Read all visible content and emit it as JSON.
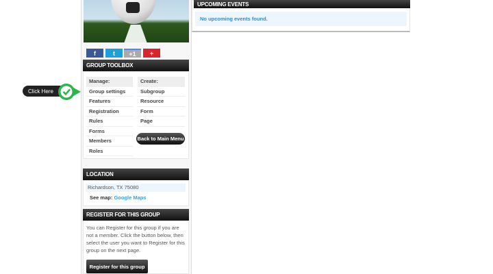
{
  "social": {
    "facebook": "f",
    "twitter": "t",
    "gplus": "+1",
    "more": "+"
  },
  "toolbox": {
    "title": "GROUP TOOLBOX",
    "manage_label": "Manage:",
    "manage_items": [
      "Group settings",
      "Features",
      "Registration",
      "Rules",
      "Forms",
      "Members",
      "Roles"
    ],
    "create_label": "Create:",
    "create_items": [
      "Subgroup",
      "Resource",
      "Form",
      "Page"
    ],
    "back_button": "Back to Main Menu"
  },
  "callout": {
    "label": "Click Here"
  },
  "location": {
    "title": "LOCATION",
    "address": "Richardson, TX 75080",
    "see_map": "See map:",
    "map_link": "Google Maps"
  },
  "register": {
    "title": "REGISTER FOR THIS GROUP",
    "text": "You can Register for this group if you are not a member. Click the button below, then select the user you want to Register for this group on the next page.",
    "button": "Register for this group"
  },
  "events": {
    "title": "UPCOMING EVENTS",
    "empty": "No upcoming events found."
  }
}
